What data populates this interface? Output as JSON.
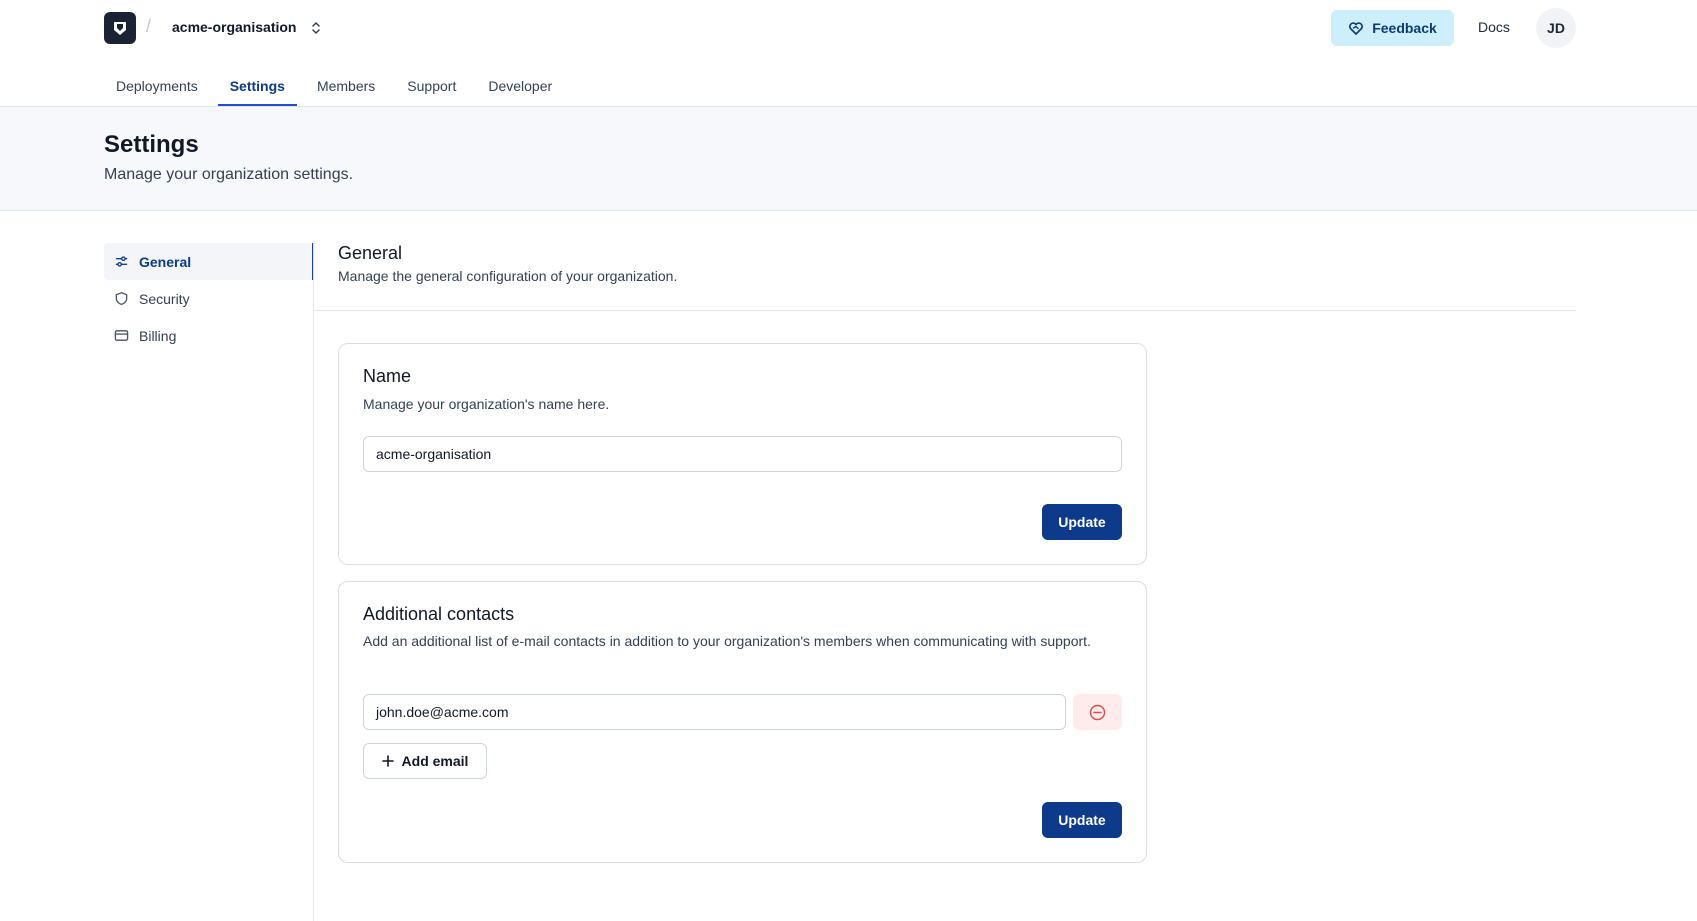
{
  "header": {
    "org_name": "acme-organisation",
    "separator": "/",
    "feedback_label": "Feedback",
    "docs_label": "Docs",
    "avatar_initials": "JD"
  },
  "tabs": [
    {
      "label": "Deployments",
      "active": false
    },
    {
      "label": "Settings",
      "active": true
    },
    {
      "label": "Members",
      "active": false
    },
    {
      "label": "Support",
      "active": false
    },
    {
      "label": "Developer",
      "active": false
    }
  ],
  "page": {
    "title": "Settings",
    "subtitle": "Manage your organization settings."
  },
  "sidebar": {
    "items": [
      {
        "label": "General",
        "icon": "sliders-icon",
        "active": true
      },
      {
        "label": "Security",
        "icon": "shield-icon",
        "active": false
      },
      {
        "label": "Billing",
        "icon": "credit-card-icon",
        "active": false
      }
    ]
  },
  "section": {
    "title": "General",
    "subtitle": "Manage the general configuration of your organization."
  },
  "name_card": {
    "title": "Name",
    "description": "Manage your organization's name here.",
    "input_value": "acme-organisation",
    "update_label": "Update"
  },
  "contacts_card": {
    "title": "Additional contacts",
    "description": "Add an additional list of e-mail contacts in addition to your organization's members when communicating with support.",
    "email_value": "john.doe@acme.com",
    "add_label": "Add email",
    "update_label": "Update"
  },
  "colors": {
    "primary": "#0d3a8a",
    "feedback_bg": "#cdeffb",
    "danger_bg": "#fdeceb",
    "danger": "#e5484d"
  }
}
